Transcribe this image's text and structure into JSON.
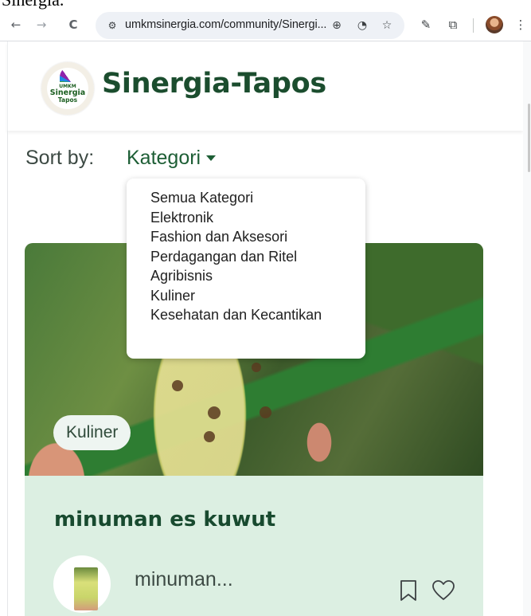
{
  "top_cut_text": "Sinergia.",
  "browser": {
    "back_symbol": "←",
    "forward_symbol": "→",
    "reload_symbol": "C",
    "site_info_symbol": "⚙",
    "url": "umkmsinergia.com/community/Sinergi...",
    "zoom_symbol": "⊕",
    "performance_symbol": "◔",
    "bookmark_symbol": "☆",
    "pen_symbol": "✎",
    "extensions_symbol": "⧉",
    "menu_symbol": "⋮"
  },
  "header": {
    "logo_text_line1": "UMKM",
    "logo_text_line2": "Sinergia",
    "logo_text_line3": "Tapos",
    "title": "Sinergia-Tapos"
  },
  "sort": {
    "label": "Sort by:",
    "selected": "Kategori"
  },
  "dropdown": {
    "options": [
      "Semua Kategori",
      "Elektronik",
      "Fashion dan Aksesori",
      "Perdagangan dan Ritel",
      "Agribisnis",
      "Kuliner",
      "Kesehatan dan Kecantikan"
    ]
  },
  "card": {
    "category": "Kuliner",
    "title": "minuman es kuwut",
    "author": "minuman..."
  },
  "colors": {
    "brand_green": "#1b4d2e",
    "accent_green": "#1d5e35",
    "card_body": "#dcefe2"
  }
}
